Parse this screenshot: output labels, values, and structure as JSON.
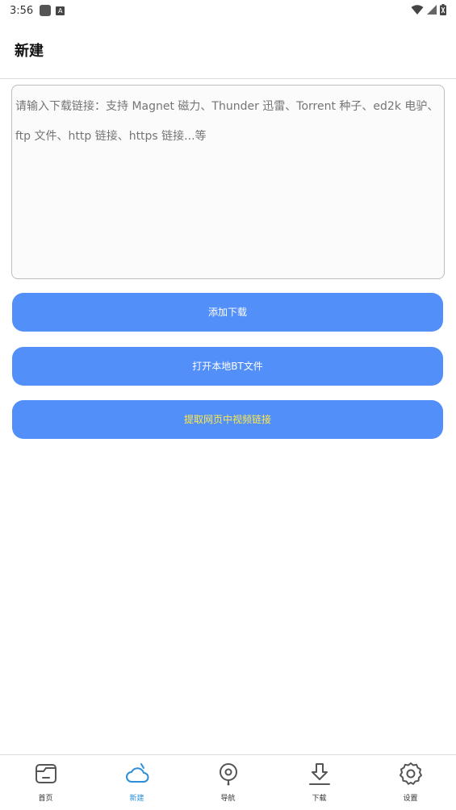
{
  "status_bar": {
    "time": "3:56",
    "left_icons": [
      "notification-square-icon",
      "a-icon"
    ],
    "right_icons": [
      "wifi-icon",
      "signal-icon",
      "battery-icon"
    ],
    "battery_indicator": "x"
  },
  "header": {
    "title": "新建"
  },
  "link_input": {
    "placeholder": "请输入下载链接：支持 Magnet 磁力、Thunder 迅雷、Torrent 种子、ed2k 电驴、ftp 文件、http 链接、https 链接...等",
    "value": ""
  },
  "actions": {
    "add_download": "添加下载",
    "open_local_bt": "打开本地BT文件",
    "extract_video_link": "提取网页中视频链接"
  },
  "bottom_nav": {
    "items": [
      {
        "label": "首页",
        "icon": "folder-icon"
      },
      {
        "label": "新建",
        "icon": "cloud-icon",
        "active": true
      },
      {
        "label": "导航",
        "icon": "location-pin-icon"
      },
      {
        "label": "下载",
        "icon": "download-icon"
      },
      {
        "label": "设置",
        "icon": "settings-gear-icon"
      }
    ]
  },
  "colors": {
    "button_bg": "#528ff9",
    "button_text": "#ffffff",
    "extract_text": "#ffe84a",
    "nav_active": "#2c8fd8",
    "nav_inactive": "#333333"
  }
}
